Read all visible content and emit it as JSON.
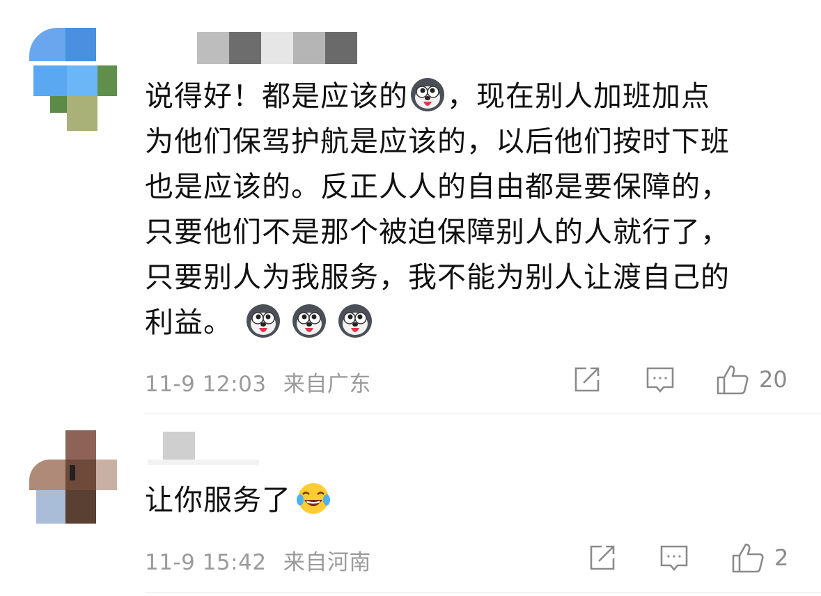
{
  "comments": [
    {
      "text_parts": {
        "a": "说得好！都是应该的",
        "b": "，现在别人加班加点\n为他们保驾护航是应该的，以后他们按时下班\n也是应该的。反正人人的自由都是要保障的，\n只要他们不是那个被迫保障别人的人就行了，\n只要别人为我服务，我不能为别人让渡自己的\n利益。"
      },
      "emoji_name": "husky-dog-emoji",
      "time": "11-9 12:03",
      "location": "来自广东",
      "likes": "20"
    },
    {
      "text": "让你服务了",
      "emoji_name": "laugh-cry-emoji",
      "time": "11-9 15:42",
      "location": "来自河南",
      "likes": "2"
    }
  ],
  "colors": {
    "meta": "#9a9a9a",
    "text": "#111111",
    "divider": "#e6e6e6",
    "icon": "#8a8a8a"
  }
}
